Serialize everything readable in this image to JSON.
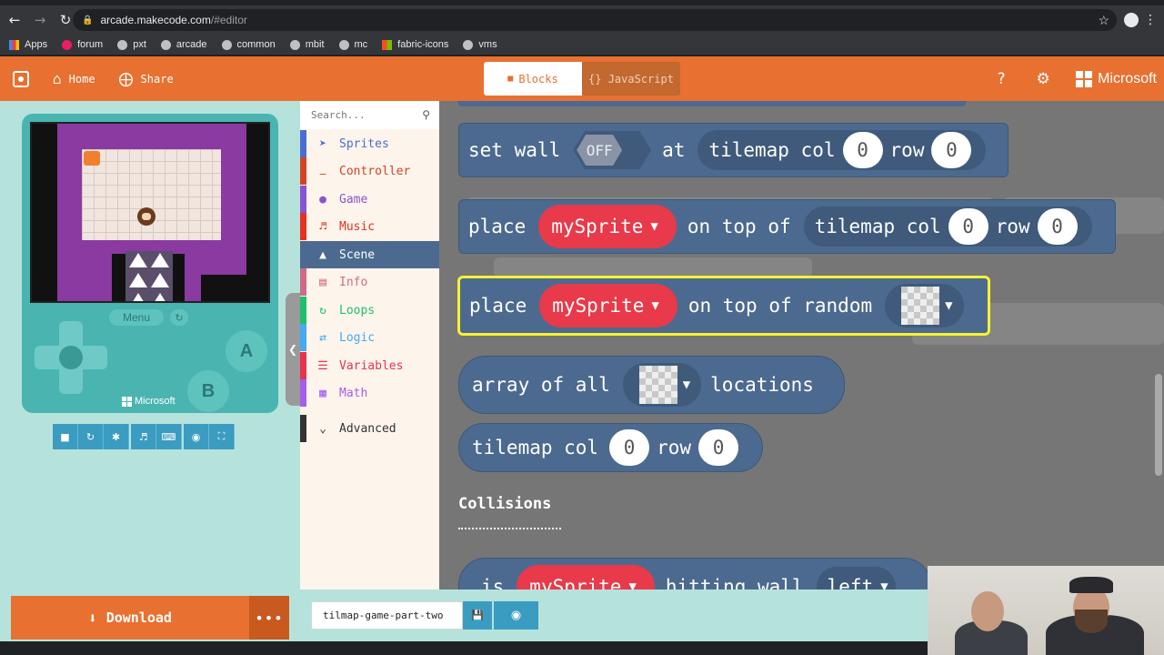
{
  "browser": {
    "url_host": "arcade.makecode.com",
    "url_path": "/#editor",
    "bookmarks": [
      "Apps",
      "forum",
      "pxt",
      "arcade",
      "common",
      "mbit",
      "mc",
      "fabric-icons",
      "vms"
    ]
  },
  "header": {
    "home_label": "Home",
    "share_label": "Share",
    "blocks_label": "Blocks",
    "javascript_label": "{} JavaScript",
    "brand": "Microsoft"
  },
  "simulator": {
    "menu_label": "Menu",
    "a_label": "A",
    "b_label": "B",
    "brand": "Microsoft"
  },
  "toolbox": {
    "search_placeholder": "Search...",
    "categories": [
      {
        "label": "Sprites",
        "icon": "paper-plane-icon",
        "color": "#4b6cd4"
      },
      {
        "label": "Controller",
        "icon": "gamepad-icon",
        "color": "#d54322"
      },
      {
        "label": "Game",
        "icon": "circle-icon",
        "color": "#8854d0"
      },
      {
        "label": "Music",
        "icon": "headphones-icon",
        "color": "#e63022"
      },
      {
        "label": "Scene",
        "icon": "tree-icon",
        "color": "#4c6a8f"
      },
      {
        "label": "Info",
        "icon": "id-card-icon",
        "color": "#cf6a87"
      },
      {
        "label": "Loops",
        "icon": "refresh-icon",
        "color": "#20bf6b"
      },
      {
        "label": "Logic",
        "icon": "shuffle-icon",
        "color": "#45aaf2"
      },
      {
        "label": "Variables",
        "icon": "list-icon",
        "color": "#e7344c"
      },
      {
        "label": "Math",
        "icon": "calculator-icon",
        "color": "#a55eea"
      }
    ],
    "advanced_label": "Advanced"
  },
  "blocks": {
    "set_wall": {
      "kw": "set wall",
      "toggle": "OFF",
      "at": "at",
      "tilemap": "tilemap col",
      "col": "0",
      "row_label": "row",
      "row": "0"
    },
    "place_on_tile": {
      "kw": "place",
      "sprite": "mySprite",
      "on_top": "on top of",
      "tilemap": "tilemap col",
      "col": "0",
      "row_label": "row",
      "row": "0"
    },
    "place_random": {
      "kw": "place",
      "sprite": "mySprite",
      "on_top": "on top of random"
    },
    "array_of": {
      "kw": "array of all",
      "suffix": "locations"
    },
    "tilemap_col": {
      "kw": "tilemap col",
      "col": "0",
      "row_label": "row",
      "row": "0"
    },
    "collisions_label": "Collisions",
    "hitting": {
      "kw": "is",
      "sprite": "mySprite",
      "mid": "hitting wall",
      "dir": "left"
    }
  },
  "project": {
    "filename": "tilmap-game-part-two",
    "download_label": "Download"
  },
  "colors": {
    "accent": "#e87030",
    "scene": "#4c6a8f",
    "sprite_var": "#e83a4a",
    "selected_outline": "#f8f230"
  }
}
